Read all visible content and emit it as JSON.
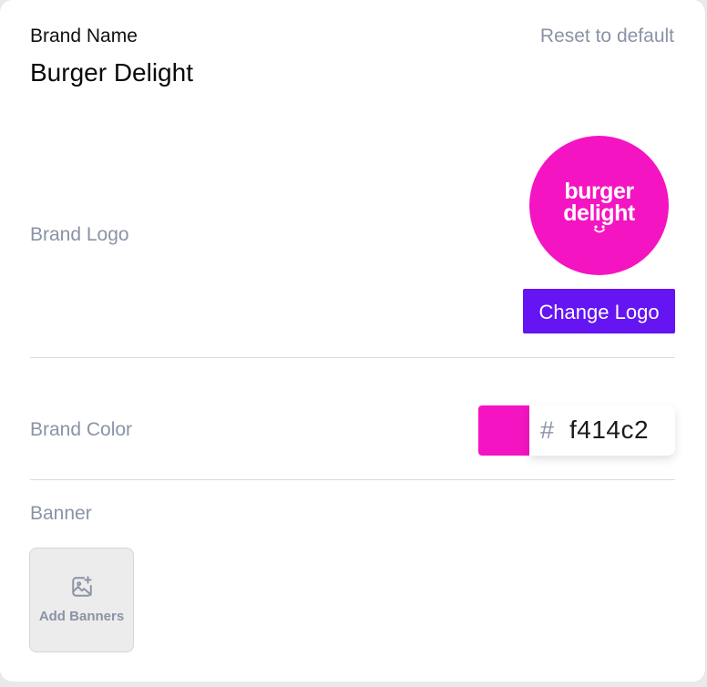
{
  "brand_name": {
    "label": "Brand Name",
    "value": "Burger Delight",
    "reset_label": "Reset to default"
  },
  "brand_logo": {
    "label": "Brand Logo",
    "logo_line1": "burger",
    "logo_line2": "delight",
    "logo_color": "#f414c2",
    "change_button_label": "Change Logo",
    "button_color": "#6415f2"
  },
  "brand_color": {
    "label": "Brand Color",
    "hash": "#",
    "value": "f414c2",
    "swatch_color": "#f414c2"
  },
  "banner": {
    "label": "Banner",
    "add_label": "Add Banners",
    "icon": "image-plus-icon"
  }
}
